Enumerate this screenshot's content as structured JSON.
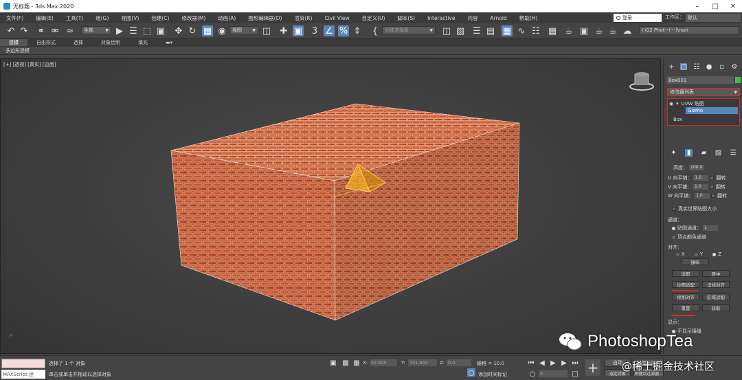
{
  "window": {
    "title": "无标题 - 3ds Max 2020"
  },
  "menu": [
    "文件(F)",
    "编辑(E)",
    "工具(T)",
    "组(G)",
    "视图(V)",
    "创建(C)",
    "修改器(M)",
    "动画(A)",
    "图形编辑器(D)",
    "渲染(R)",
    "Civil View",
    "自定义(U)",
    "脚本(S)",
    "Interactive",
    "内容",
    "Arnold",
    "帮助(H)"
  ],
  "search": {
    "value": "登录"
  },
  "workspace": {
    "label": "工作区：",
    "value": "默认"
  },
  "toolbar": {
    "selection_filter": "全部",
    "ref_coord": "视图",
    "named_selection": "创建选择集",
    "path": "I:\\02 Phot~(一)\\nari"
  },
  "ribbon": {
    "tabs": [
      "建模",
      "自由形式",
      "选择",
      "对象绘制",
      "填充"
    ],
    "active": 0,
    "subtitle": "多边形建模"
  },
  "viewport": {
    "label": "[+] [透视] [真实] [边面]"
  },
  "panel": {
    "object_name": "Box001",
    "object_color": "#3cbd4a",
    "modifier_list": "修改器列表",
    "stack": {
      "group": "UVW 贴图",
      "gizmo": "Gizmo",
      "base": "Box"
    },
    "params": {
      "height_label": "高度：",
      "height_value": "100.0",
      "u_tile": "U 向平铺：",
      "v_tile": "V 向平铺：",
      "w_tile": "W 向平铺：",
      "tile_value": "1.0",
      "flip": "翻转",
      "real_world": "真实世界贴图大小",
      "channel_title": "通道：",
      "map_channel": "贴图通道：",
      "map_channel_value": "1",
      "vertex_color": "顶点颜色通道",
      "align_title": "对齐：",
      "axes": [
        "X",
        "Y",
        "Z"
      ],
      "btn_manip": "操纵",
      "btn_fit": "适配",
      "btn_center": "居中",
      "btn_bitmap_fit": "位图适配",
      "btn_normal_align": "法线对齐",
      "btn_view_align": "视图对齐",
      "btn_region_fit": "区域适配",
      "btn_reset": "重置",
      "btn_acquire": "获取",
      "display_title": "显示：",
      "no_seams": "不显示接缝"
    }
  },
  "status": {
    "maxscript": "MAXScript 迷",
    "selected": "选择了 1 个 对象",
    "hint": "单击或单击并拖动以选择对象",
    "x_label": "X:",
    "x_val": "32.825",
    "y_label": "Y:",
    "y_val": "701.834",
    "z_label": "Z:",
    "z_val": "0.0",
    "grid": "栅格 = 10.0",
    "add_time_tag": "添加时间标记",
    "auto": "自动",
    "set_key": "设置关键点",
    "selected_obj": "选定对象",
    "frame": "0",
    "filters": "关键点过滤器..."
  },
  "watermark": {
    "brand": "PhotoshopTea",
    "sub": "@稀土掘金技术社区"
  }
}
